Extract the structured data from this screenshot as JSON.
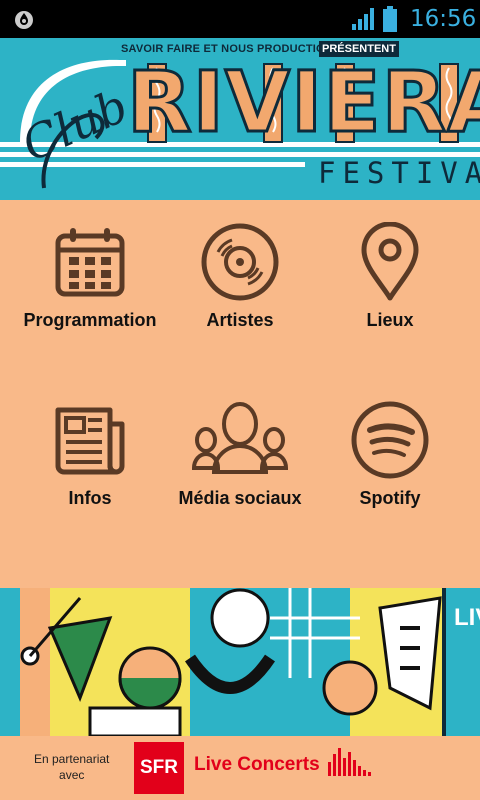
{
  "status_bar": {
    "clock": "16:56"
  },
  "header": {
    "presenters": "SAVOIR FAIRE ET NOUS PRODUCTIONS",
    "presenter_badge": "PRÉSENTENT",
    "script_word": "Club",
    "title": "RIVIERA",
    "subtitle": "FESTIVAL"
  },
  "menu": {
    "items": [
      {
        "label": "Programmation",
        "icon": "calendar-icon"
      },
      {
        "label": "Artistes",
        "icon": "vinyl-record-icon"
      },
      {
        "label": "Lieux",
        "icon": "map-pin-icon"
      },
      {
        "label": "Infos",
        "icon": "newspaper-icon"
      },
      {
        "label": "Média sociaux",
        "icon": "people-group-icon"
      },
      {
        "label": "Spotify",
        "icon": "spotify-icon"
      }
    ]
  },
  "art_banner": {
    "live_label": "LIVE"
  },
  "footer": {
    "partner_line1": "En partenariat",
    "partner_line2": "avec",
    "sfr": "SFR",
    "live_concerts": "Live Concerts"
  },
  "colors": {
    "background": "#f9b989",
    "teal": "#2db3c6",
    "navy": "#0e2a3a",
    "icon_brown": "#5a3a25",
    "sfr_red": "#e2001a",
    "status_blue": "#3ab0e0"
  }
}
